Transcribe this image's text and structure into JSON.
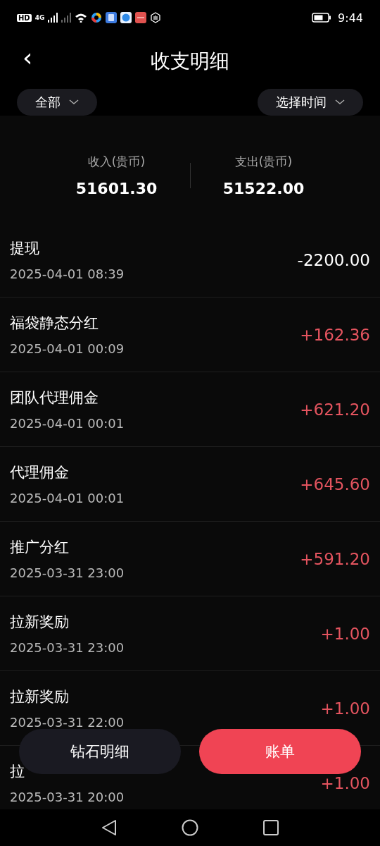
{
  "status_bar": {
    "time": "9:44",
    "hd": "HD",
    "network": "4G"
  },
  "header": {
    "back": "‹",
    "title": "收支明细"
  },
  "filters": [
    {
      "label": "全部"
    },
    {
      "label": "选择时间"
    }
  ],
  "summary": [
    {
      "label": "收入(贵币)",
      "value": "51601.30"
    },
    {
      "label": "支出(贵币)",
      "value": "51522.00"
    }
  ],
  "records": [
    {
      "title": "提现",
      "time": "2025-04-01 08:39",
      "amount": "-2200.00",
      "kind": "expense"
    },
    {
      "title": "福袋静态分红",
      "time": "2025-04-01 00:09",
      "amount": "+162.36",
      "kind": "income"
    },
    {
      "title": "团队代理佣金",
      "time": "2025-04-01 00:01",
      "amount": "+621.20",
      "kind": "income"
    },
    {
      "title": "代理佣金",
      "time": "2025-04-01 00:01",
      "amount": "+645.60",
      "kind": "income"
    },
    {
      "title": "推广分红",
      "time": "2025-03-31 23:00",
      "amount": "+591.20",
      "kind": "income"
    },
    {
      "title": "拉新奖励",
      "time": "2025-03-31 23:00",
      "amount": "+1.00",
      "kind": "income"
    },
    {
      "title": "拉新奖励",
      "time": "2025-03-31 22:00",
      "amount": "+1.00",
      "kind": "income"
    },
    {
      "title": "拉",
      "time": "2025-03-31 20:00",
      "amount": "+1.00",
      "kind": "income"
    }
  ],
  "bottom_buttons": [
    {
      "label": "钻石明细",
      "selected": false
    },
    {
      "label": "账单",
      "selected": true
    }
  ]
}
